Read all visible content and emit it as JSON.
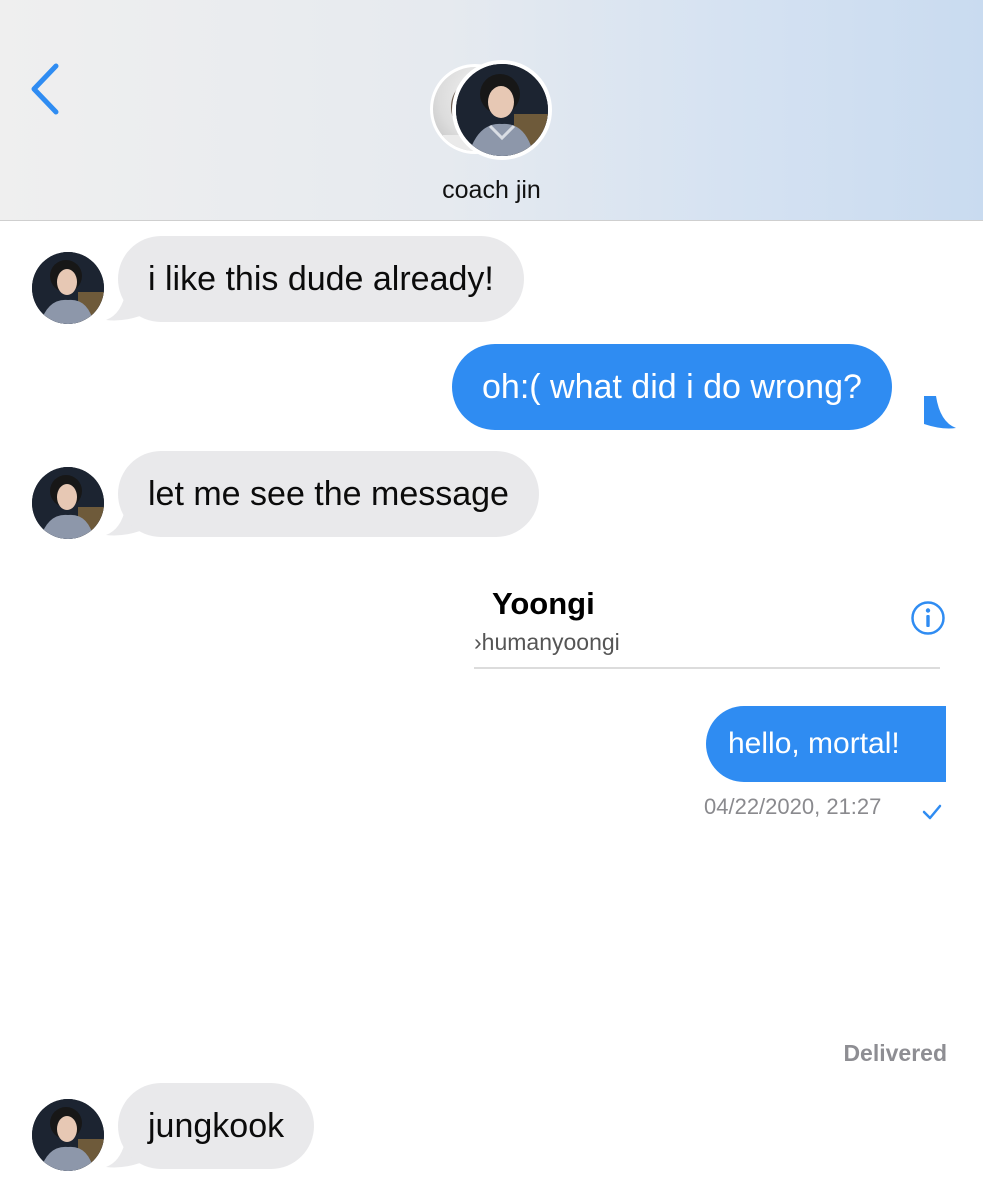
{
  "header": {
    "contact_name": "coach jin",
    "back_icon": "chevron-left-icon"
  },
  "thread": {
    "messages": [
      {
        "direction": "incoming",
        "text": "i like this dude already!"
      },
      {
        "direction": "outgoing",
        "text": "oh:( what did i do wrong?"
      },
      {
        "direction": "incoming",
        "text": "let me see the message"
      },
      {
        "direction": "incoming",
        "text": "jungkook"
      }
    ],
    "status": "Delivered"
  },
  "shared_screenshot": {
    "name": "Yoongi",
    "handle": "›humanyoongi",
    "message": "hello, mortal!",
    "timestamp": "04/22/2020, 21:27"
  },
  "colors": {
    "accent_blue": "#2f8cf2",
    "incoming_bubble": "#e9e9eb"
  }
}
